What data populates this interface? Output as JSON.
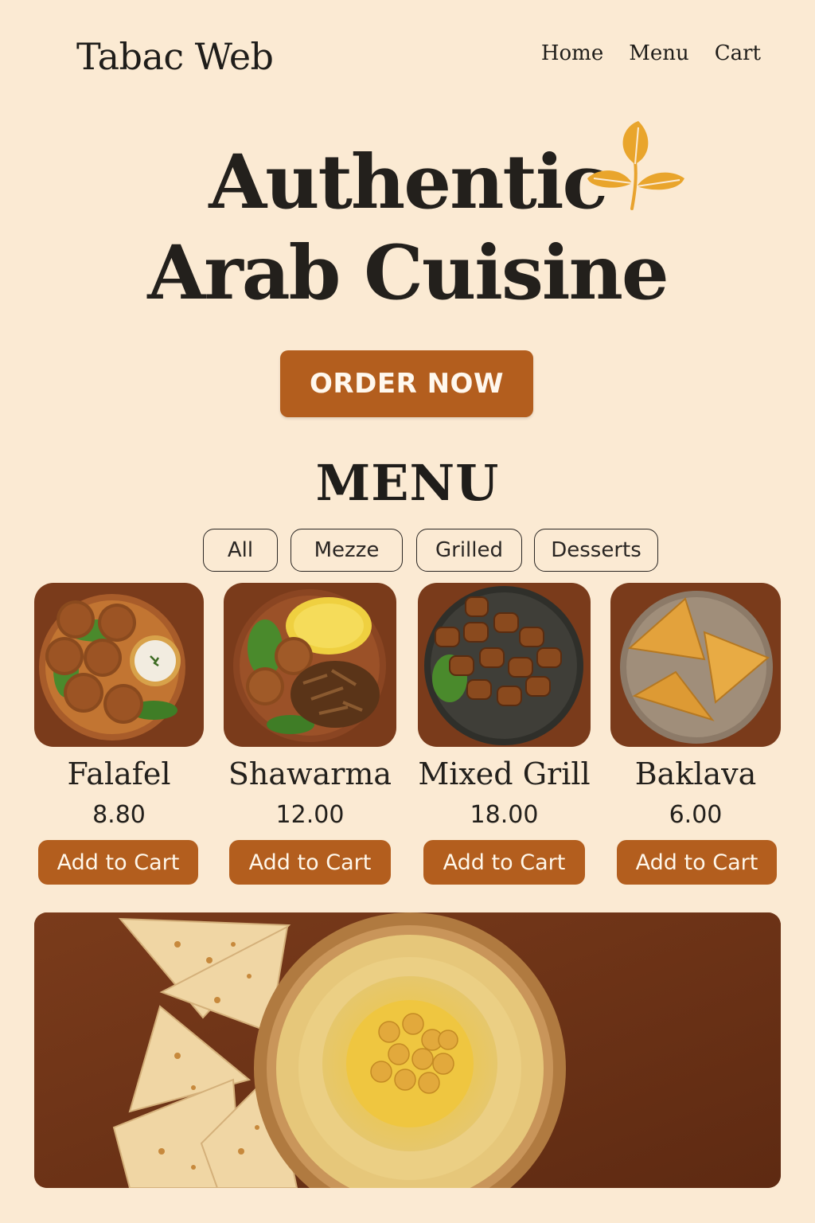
{
  "header": {
    "brand": "Tabac Web",
    "nav": [
      "Home",
      "Menu",
      "Cart"
    ]
  },
  "hero": {
    "title_line1": "Authentic",
    "title_line2": "Arab Cuisine",
    "cta_label": "ORDER NOW",
    "icon": "leaf-icon"
  },
  "menu": {
    "title": "MENU",
    "filters": [
      "All",
      "Mezze",
      "Grilled",
      "Desserts"
    ],
    "items": [
      {
        "name": "Falafel",
        "price": "8.80",
        "button": "Add to Cart",
        "image": "falafel-plate"
      },
      {
        "name": "Shawarma",
        "price": "12.00",
        "button": "Add to Cart",
        "image": "shawarma-plate"
      },
      {
        "name": "Mixed Grill",
        "price": "18.00",
        "button": "Add to Cart",
        "image": "mixed-grill-plate"
      },
      {
        "name": "Baklava",
        "price": "6.00",
        "button": "Add to Cart",
        "image": "baklava-plate"
      }
    ]
  },
  "banner": {
    "image": "hummus-with-pita"
  },
  "colors": {
    "background": "#fbead3",
    "accent": "#b35e1e",
    "card_background": "#7a3b1b",
    "text": "#1f1d1a"
  }
}
